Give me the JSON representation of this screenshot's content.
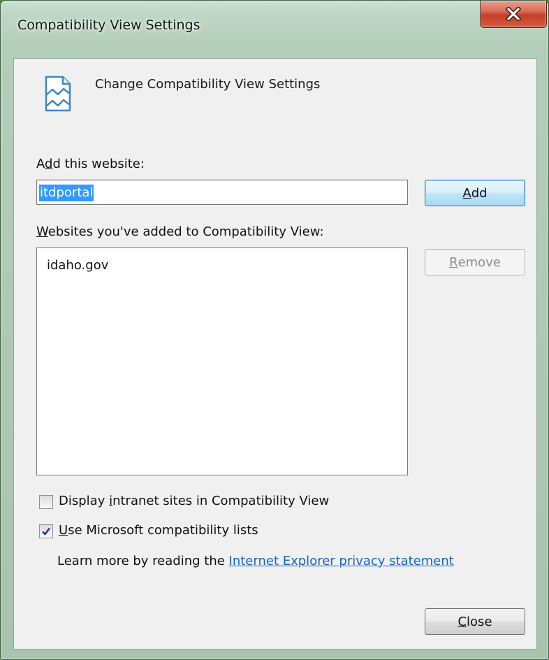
{
  "window": {
    "title": "Compatibility View Settings",
    "close_icon": "close-x-icon"
  },
  "header": {
    "icon": "compatibility-view-icon",
    "text": "Change Compatibility View Settings"
  },
  "add_section": {
    "label_pre": "A",
    "label_key": "d",
    "label_post": "d this website:",
    "input_value": "itdportal",
    "add_button_key": "A",
    "add_button_rest": "dd"
  },
  "list_section": {
    "label_key": "W",
    "label_post": "ebsites you've added to Compatibility View:",
    "items": [
      "idaho.gov"
    ],
    "remove_button_key": "R",
    "remove_button_rest": "emove"
  },
  "options": {
    "intranet_pre": "Display ",
    "intranet_key": "i",
    "intranet_post": "ntranet sites in Compatibility View",
    "intranet_checked": false,
    "ms_lists_key": "U",
    "ms_lists_post": "se Microsoft compatibility lists",
    "ms_lists_checked": true
  },
  "learn_more": {
    "text": "Learn more by reading the ",
    "link": "Internet Explorer privacy statement"
  },
  "footer": {
    "close_button_key": "C",
    "close_button_rest": "lose"
  },
  "colors": {
    "link": "#1565c0",
    "selection": "#3399ff",
    "close_button_red": "#c23f27"
  }
}
